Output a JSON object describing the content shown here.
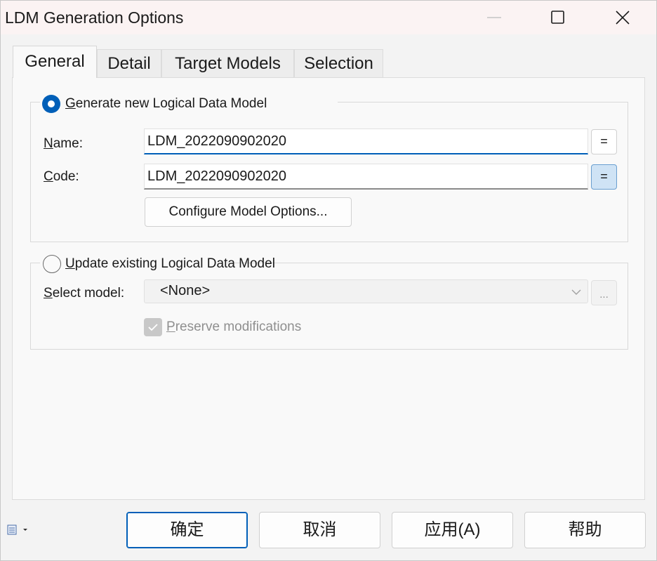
{
  "window": {
    "title": "LDM Generation Options"
  },
  "tabs": [
    {
      "label": "General",
      "active": true
    },
    {
      "label": "Detail",
      "active": false
    },
    {
      "label": "Target Models",
      "active": false
    },
    {
      "label": "Selection",
      "active": false
    }
  ],
  "generate_group": {
    "radio_label_first": "G",
    "radio_label_rest": "enerate new Logical Data Model",
    "selected": true,
    "name_label_first": "N",
    "name_label_rest": "ame:",
    "name_value": "LDM_2022090902020",
    "name_equals": "=",
    "code_label_first": "C",
    "code_label_rest": "ode:",
    "code_value": "LDM_2022090902020",
    "code_equals": "=",
    "configure_button": "Configure Model Options..."
  },
  "update_group": {
    "radio_label_first": "U",
    "radio_label_rest": "pdate existing Logical Data Model",
    "selected": false,
    "select_label_first": "S",
    "select_label_rest": "elect model:",
    "select_value": "<None>",
    "browse_button": "...",
    "preserve_label_first": "P",
    "preserve_label_rest": "reserve modifications",
    "preserve_checked": true
  },
  "footer": {
    "ok": "确定",
    "cancel": "取消",
    "apply": "应用(A)",
    "help": "帮助"
  },
  "colors": {
    "accent": "#005fb8",
    "titlebar": "#fbf3f3",
    "panel": "#f9f9f9"
  }
}
